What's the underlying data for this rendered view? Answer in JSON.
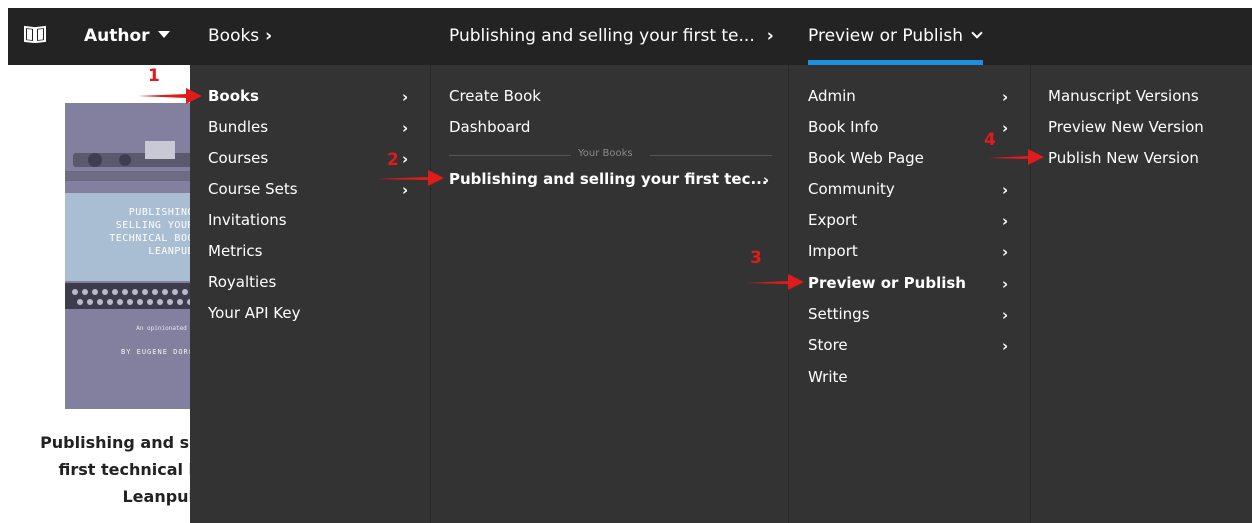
{
  "topbar": {
    "author_label": "Author",
    "books_label": "Books",
    "book_title_crumb": "Publishing and selling your first te...",
    "current_page": "Preview or Publish",
    "chevron": "›",
    "accent_color": "#1a8fe3",
    "icons": [
      "book-icon",
      "caret-down-icon",
      "chevron-right-icon",
      "chevron-down-icon"
    ]
  },
  "card": {
    "cover": {
      "lines": [
        "PUBLISHING",
        "SELLING YOUR",
        "TECHNICAL BOO",
        "LEANPUB"
      ],
      "subtitle": "An opinionated g",
      "author": "BY EUGENE DORF"
    },
    "title_lines": [
      "Publishing and se",
      "first technical b",
      "Leanpub"
    ]
  },
  "menu": {
    "col1": [
      {
        "label": "Books",
        "arrow": "›",
        "selected": true
      },
      {
        "label": "Bundles",
        "arrow": "›"
      },
      {
        "label": "Courses",
        "arrow": "›"
      },
      {
        "label": "Course Sets",
        "arrow": "›"
      },
      {
        "label": "Invitations"
      },
      {
        "label": "Metrics"
      },
      {
        "label": "Royalties"
      },
      {
        "label": "Your API Key"
      }
    ],
    "col2": {
      "items": [
        {
          "label": "Create Book"
        },
        {
          "label": "Dashboard"
        }
      ],
      "section_label": "Your Books",
      "book": {
        "label": "Publishing and selling your first tec...",
        "arrow": "›"
      }
    },
    "col3": [
      {
        "label": "Admin",
        "arrow": "›"
      },
      {
        "label": "Book Info",
        "arrow": "›"
      },
      {
        "label": "Book Web Page"
      },
      {
        "label": "Community",
        "arrow": "›"
      },
      {
        "label": "Export",
        "arrow": "›"
      },
      {
        "label": "Import",
        "arrow": "›"
      },
      {
        "label": "Preview or Publish",
        "arrow": "›",
        "selected": true
      },
      {
        "label": "Settings",
        "arrow": "›"
      },
      {
        "label": "Store",
        "arrow": "›"
      },
      {
        "label": "Write"
      }
    ],
    "col4": [
      {
        "label": "Manuscript Versions"
      },
      {
        "label": "Preview New Version"
      },
      {
        "label": "Publish New Version"
      }
    ]
  },
  "annotations": {
    "markers": [
      "1",
      "2",
      "3",
      "4"
    ],
    "color": "#e01b1b"
  }
}
